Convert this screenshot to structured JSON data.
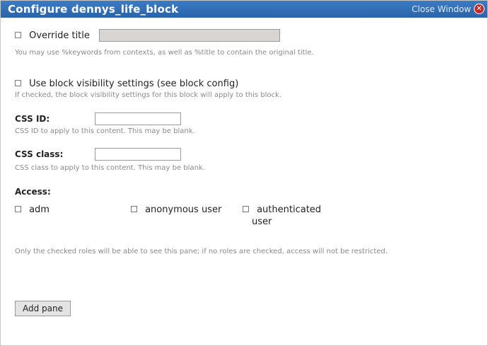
{
  "window": {
    "title": "Configure dennys_life_block",
    "close_label": "Close Window"
  },
  "override": {
    "label": "Override title",
    "value": "",
    "description": "You may use %keywords from contexts, as well as %title to contain the original title."
  },
  "visibility": {
    "label": "Use block visibility settings (see block config)",
    "description": "If checked, the block visibility settings for this block will apply to this block."
  },
  "css_id": {
    "label": "CSS ID:",
    "value": "",
    "description": "CSS ID to apply to this content. This may be blank."
  },
  "css_class": {
    "label": "CSS class:",
    "value": "",
    "description": "CSS class to apply to this content. This may be blank."
  },
  "access": {
    "label": "Access:",
    "roles": [
      "adm",
      "anonymous user",
      "authenticated",
      "user"
    ],
    "description": "Only the checked roles will be able to see this pane; if no roles are checked, access will not be restricted."
  },
  "add_pane_label": "Add pane"
}
